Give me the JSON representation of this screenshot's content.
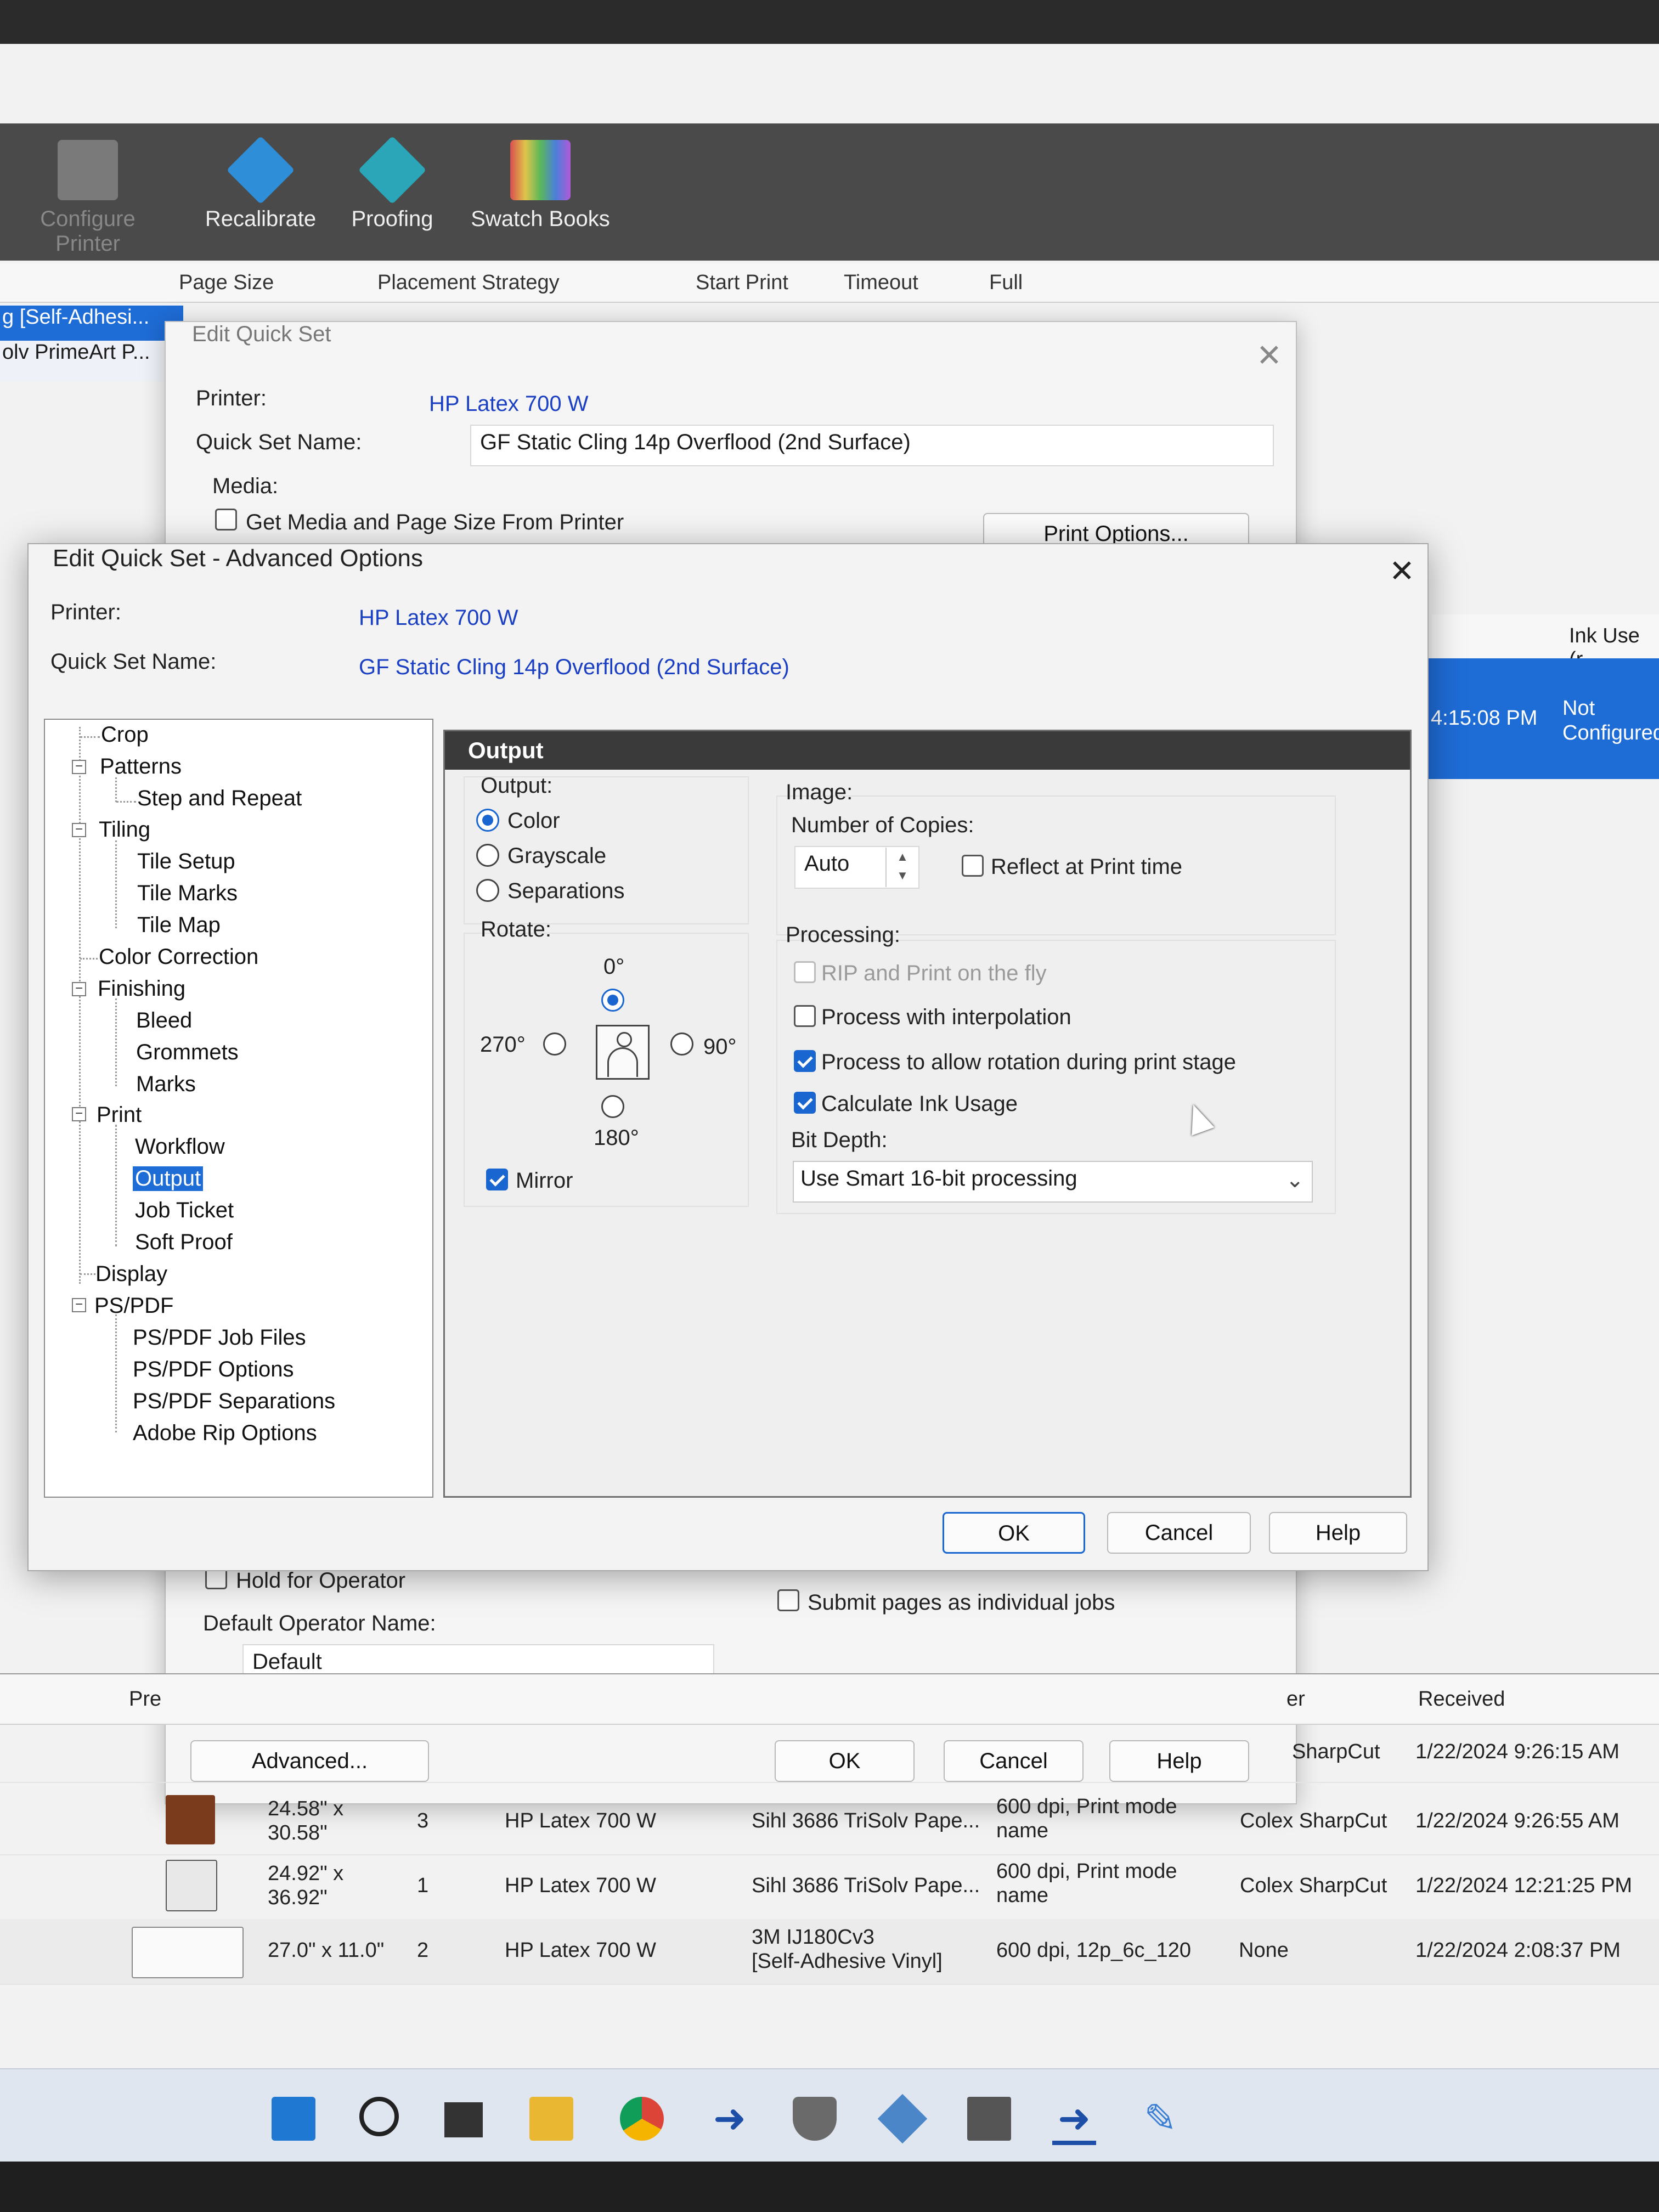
{
  "ribbon": {
    "items": [
      {
        "label": "Configure Printer",
        "icon": "printer-icon",
        "color": "#9a9a9a"
      },
      {
        "label": "Recalibrate",
        "icon": "recalibrate-icon",
        "color": "#2e8fd8"
      },
      {
        "label": "Proofing",
        "icon": "proofing-eye-icon",
        "color": "#2aa6b8"
      },
      {
        "label": "Swatch Books",
        "icon": "swatch-grid-icon",
        "color": "#c86aa6"
      }
    ]
  },
  "bg_columns": [
    "Page Size",
    "Placement Strategy",
    "Start Print",
    "Timeout",
    "Full"
  ],
  "bg_left_rows": [
    "g [Self-Adhesi...",
    "olv PrimeArt P..."
  ],
  "bg_right": {
    "ink_use": "Ink Use (r",
    "time": "4:15:08 PM",
    "status_line1": "Not",
    "status_line2": "Configured"
  },
  "back_dialog": {
    "title": "Edit Quick Set",
    "printer_label": "Printer:",
    "printer_value": "HP Latex 700 W",
    "quickset_label": "Quick Set Name:",
    "quickset_value": "GF Static Cling 14p Overflood (2nd Surface)",
    "media_label": "Media:",
    "media_checkbox": "Get Media and Page Size From Printer",
    "print_options_button": "Print Options...",
    "hold_checkbox": "Hold for Operator",
    "default_operator_label": "Default Operator Name:",
    "default_operator_value": "Default",
    "submit_checkbox": "Submit pages as individual jobs",
    "advanced_button": "Advanced...",
    "ok": "OK",
    "cancel": "Cancel",
    "help": "Help"
  },
  "dialog": {
    "title": "Edit Quick Set - Advanced Options",
    "printer_label": "Printer:",
    "printer_value": "HP Latex 700 W",
    "quickset_label": "Quick Set Name:",
    "quickset_value": "GF Static Cling 14p Overflood (2nd Surface)",
    "ok": "OK",
    "cancel": "Cancel",
    "help": "Help"
  },
  "tree": {
    "crop": "Crop",
    "patterns": "Patterns",
    "step_and_repeat": "Step and Repeat",
    "tiling": "Tiling",
    "tile_setup": "Tile Setup",
    "tile_marks": "Tile Marks",
    "tile_map": "Tile Map",
    "color_correction": "Color Correction",
    "finishing": "Finishing",
    "bleed": "Bleed",
    "grommets": "Grommets",
    "marks": "Marks",
    "print": "Print",
    "workflow": "Workflow",
    "output": "Output",
    "job_ticket": "Job Ticket",
    "soft_proof": "Soft Proof",
    "display": "Display",
    "pspdf": "PS/PDF",
    "pspdf_job_files": "PS/PDF Job Files",
    "pspdf_options": "PS/PDF Options",
    "pspdf_separations": "PS/PDF Separations",
    "adobe_rip_options": "Adobe Rip Options"
  },
  "panel": {
    "title": "Output",
    "output_label": "Output:",
    "output_options": [
      "Color",
      "Grayscale",
      "Separations"
    ],
    "output_selected": "Color",
    "rotate_label": "Rotate:",
    "rot_0": "0°",
    "rot_90": "90°",
    "rot_180": "180°",
    "rot_270": "270°",
    "rotate_selected": "0°",
    "mirror": "Mirror",
    "mirror_checked": true,
    "image_label": "Image:",
    "copies_label": "Number of Copies:",
    "copies_value": "Auto",
    "reflect_label": "Reflect at Print time",
    "reflect_checked": false,
    "processing_label": "Processing:",
    "rip_fly": "RIP and Print on the fly",
    "rip_fly_checked": false,
    "interpolation": "Process with interpolation",
    "interpolation_checked": false,
    "rotation": "Process to allow rotation during print stage",
    "rotation_checked": true,
    "ink_usage": "Calculate Ink Usage",
    "ink_usage_checked": true,
    "bit_depth_label": "Bit Depth:",
    "bit_depth_value": "Use Smart 16-bit processing"
  },
  "table": {
    "headers": {
      "pre": "Pre",
      "er": "er",
      "received": "Received"
    },
    "partial_row": {
      "cutter": "SharpCut",
      "received": "1/22/2024 9:26:15 AM"
    },
    "rows": [
      {
        "size1": "24.58\" x",
        "size2": "30.58\"",
        "copies": "3",
        "printer": "HP Latex 700 W",
        "media1": "Sihl 3686 TriSolv Pape...",
        "media2": "",
        "mode1": "600 dpi, Print mode",
        "mode2": "name",
        "cutter": "Colex SharpCut",
        "received": "1/22/2024 9:26:55 AM"
      },
      {
        "size1": "24.92\" x",
        "size2": "36.92\"",
        "copies": "1",
        "printer": "HP Latex 700 W",
        "media1": "Sihl 3686 TriSolv Pape...",
        "media2": "",
        "mode1": "600 dpi, Print mode",
        "mode2": "name",
        "cutter": "Colex SharpCut",
        "received": "1/22/2024 12:21:25 PM"
      },
      {
        "size1": "27.0\" x 11.0\"",
        "size2": "",
        "copies": "2",
        "printer": "HP Latex 700 W",
        "media1": "3M IJ180Cv3",
        "media2": "[Self-Adhesive Vinyl]",
        "mode1": "600 dpi, 12p_6c_120",
        "mode2": "",
        "cutter": "None",
        "received": "1/22/2024 2:08:37 PM"
      }
    ]
  },
  "taskbar": {
    "icons": [
      "windows-start-icon",
      "search-icon",
      "task-view-icon",
      "file-explorer-icon",
      "chrome-icon",
      "arrow-app-icon",
      "shield-app-icon",
      "gear-app-icon",
      "calculator-icon",
      "arrow-app-active-icon",
      "tool-app-icon"
    ]
  },
  "colors": {
    "accent": "#1e6cd6",
    "link_blue": "#1a3fc2",
    "title_bar": "#3a3a3a"
  }
}
